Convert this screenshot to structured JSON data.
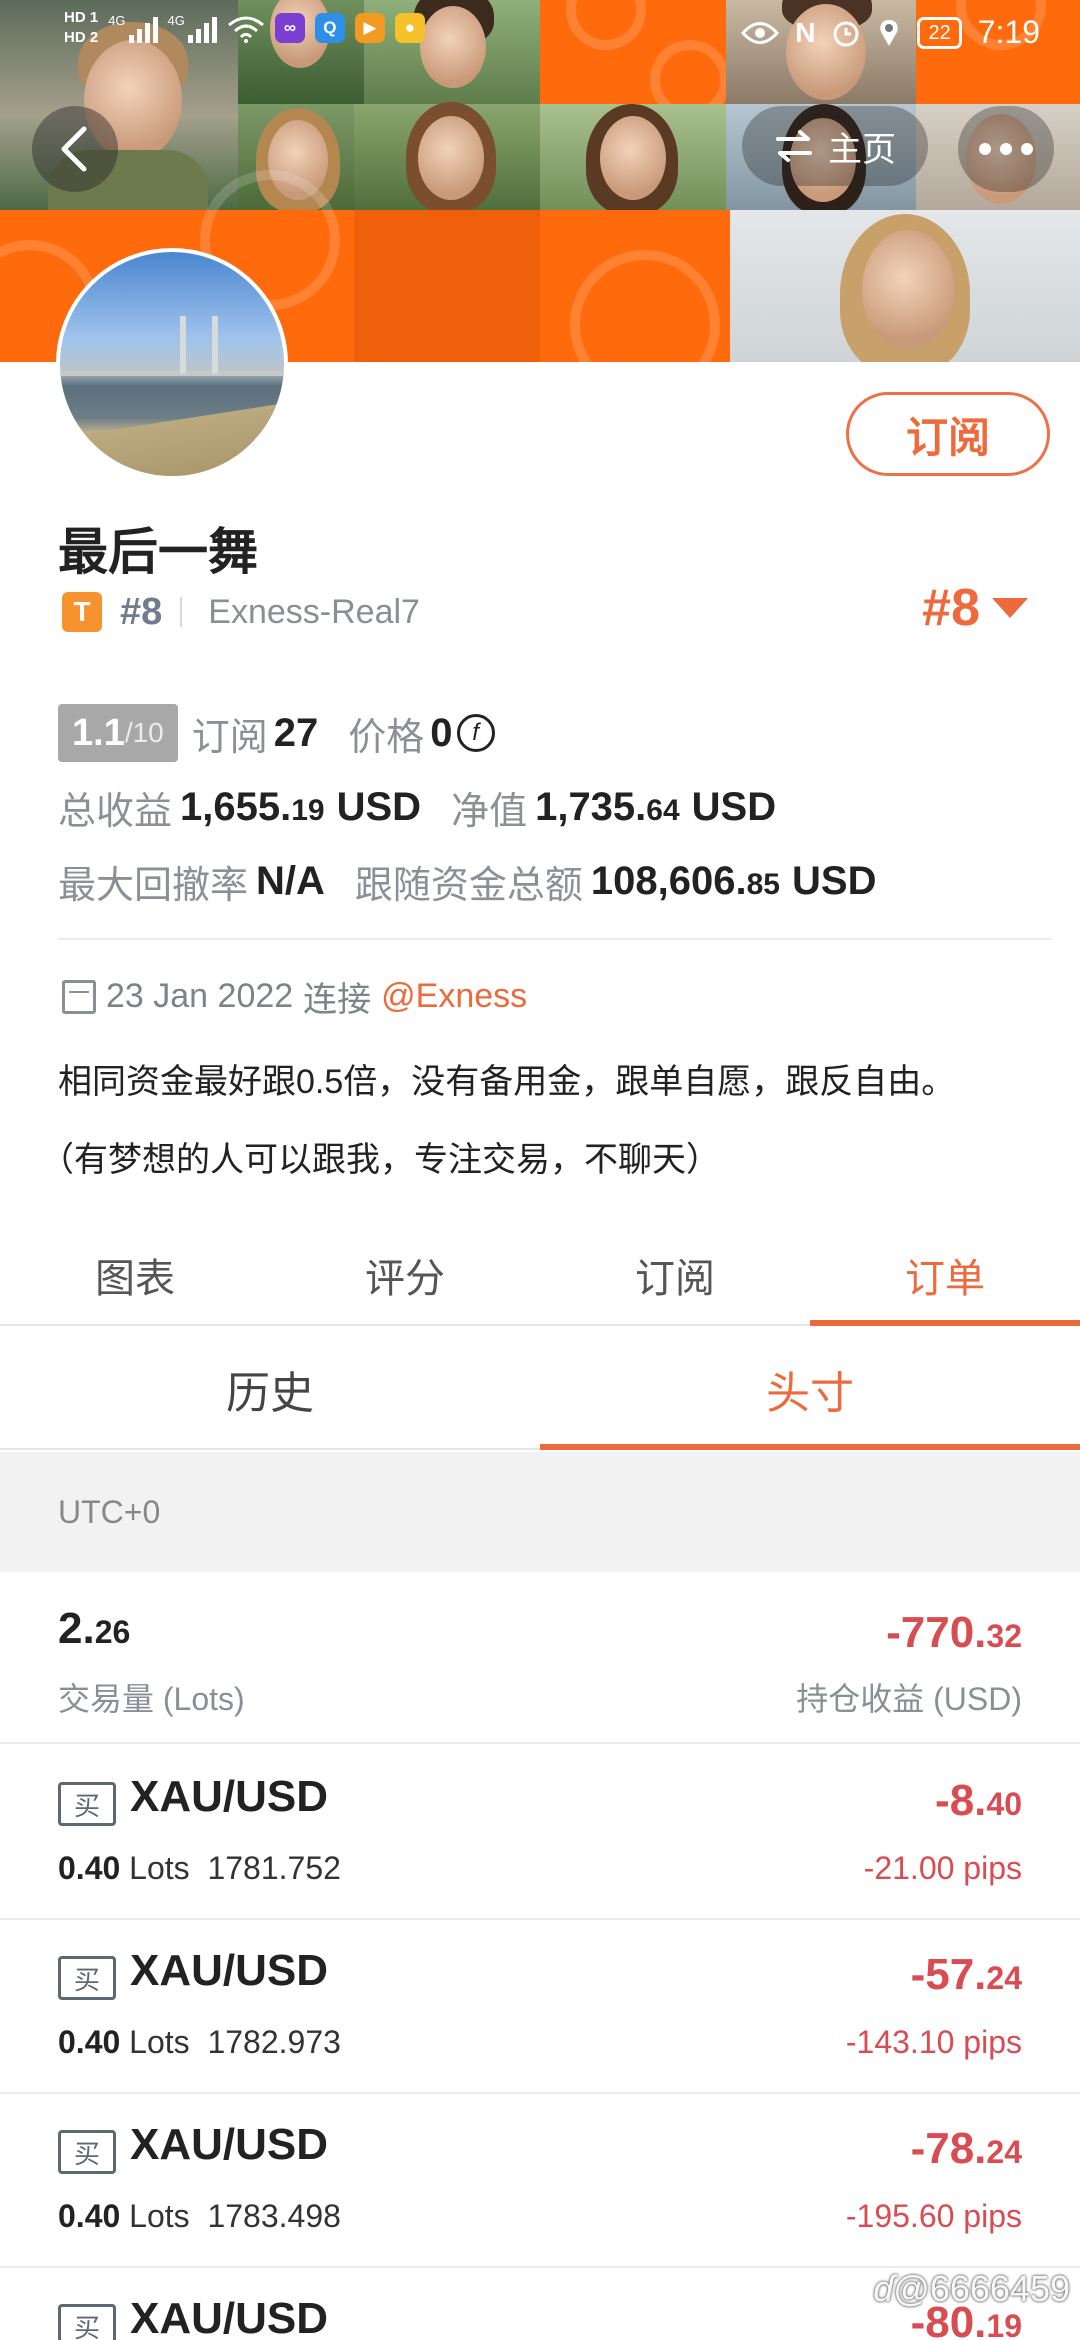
{
  "status_bar": {
    "hd1": "HD 1",
    "hd2": "HD 2",
    "net1": "4G",
    "net2": "4G",
    "battery": "22",
    "time": "7:19"
  },
  "header": {
    "home_label": "主页"
  },
  "profile": {
    "subscribe_label": "订阅",
    "name": "最后一舞",
    "badge": "T",
    "rank": "#8",
    "server": "Exness-Real7",
    "rank_right": "#8"
  },
  "stats": {
    "score": "1.1",
    "score_max": "/10",
    "subscribers_label": "订阅",
    "subscribers": "27",
    "price_label": "价格",
    "price": "0",
    "coin_symbol": "f",
    "total_profit_label": "总收益",
    "total_profit_int": "1,655.",
    "total_profit_dec": "19",
    "equity_label": "净值",
    "equity_int": "1,735.",
    "equity_dec": "64",
    "currency": "USD",
    "drawdown_label": "最大回撤率",
    "drawdown": "N/A",
    "follow_funds_label": "跟随资金总额",
    "follow_funds_int": "108,606.",
    "follow_funds_dec": "85"
  },
  "connect": {
    "date": "23 Jan 2022",
    "label": "连接",
    "broker": "@Exness"
  },
  "description": {
    "line1": "相同资金最好跟0.5倍，没有备用金，跟单自愿，跟反自由。",
    "line2": "（有梦想的人可以跟我，专注交易，不聊天）"
  },
  "tabs": [
    {
      "label": "图表",
      "active": false
    },
    {
      "label": "评分",
      "active": false
    },
    {
      "label": "订阅",
      "active": false
    },
    {
      "label": "订单",
      "active": true
    }
  ],
  "subtabs": [
    {
      "label": "历史",
      "active": false
    },
    {
      "label": "头寸",
      "active": true
    }
  ],
  "timezone": "UTC+0",
  "summary": {
    "lots_int": "2.",
    "lots_dec": "26",
    "lots_label": "交易量 (Lots)",
    "pnl_int": "-770.",
    "pnl_dec": "32",
    "pnl_label": "持仓收益 (USD)"
  },
  "orders": [
    {
      "side": "买",
      "symbol": "XAU/USD",
      "lots": "0.40",
      "lots_unit": "Lots",
      "price": "1781.752",
      "pnl_int": "-8.",
      "pnl_dec": "40",
      "pips": "-21.00 pips"
    },
    {
      "side": "买",
      "symbol": "XAU/USD",
      "lots": "0.40",
      "lots_unit": "Lots",
      "price": "1782.973",
      "pnl_int": "-57.",
      "pnl_dec": "24",
      "pips": "-143.10 pips"
    },
    {
      "side": "买",
      "symbol": "XAU/USD",
      "lots": "0.40",
      "lots_unit": "Lots",
      "price": "1783.498",
      "pnl_int": "-78.",
      "pnl_dec": "24",
      "pips": "-195.60 pips"
    },
    {
      "side": "买",
      "symbol": "XAU/USD",
      "lots": "",
      "lots_unit": "",
      "price": "",
      "pnl_int": "-80.",
      "pnl_dec": "19",
      "pips": ""
    }
  ],
  "watermark": "@6666459",
  "colors": {
    "accent": "#ec6a3c",
    "loss": "#d94c52",
    "cover_orange": "#ff6a0d"
  }
}
